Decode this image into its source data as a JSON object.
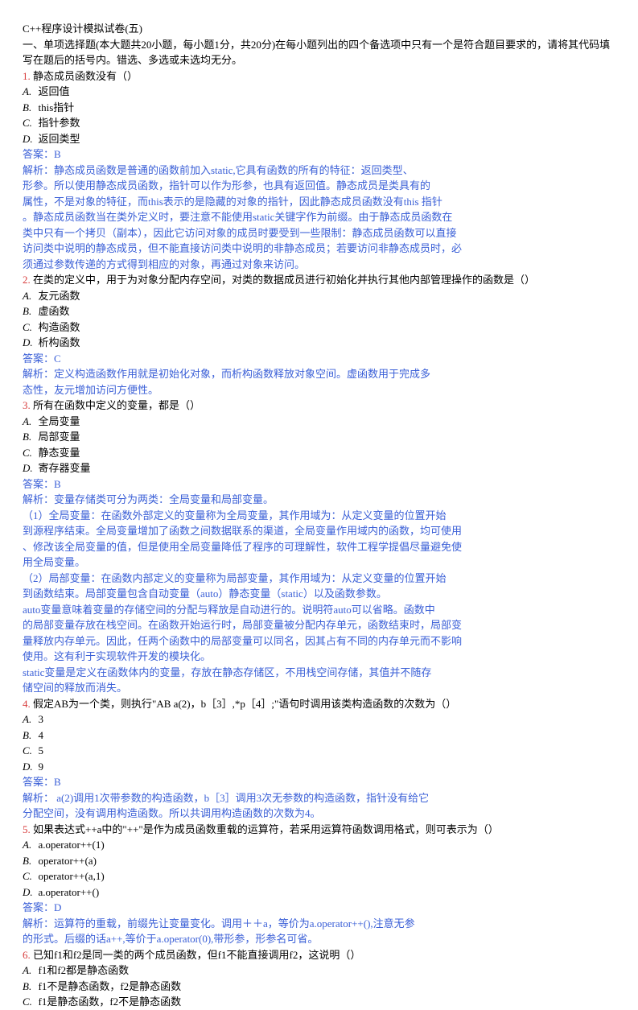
{
  "title": "C++程序设计模拟试卷(五)",
  "section_header": "一、单项选择题(本大题共20小题，每小题1分，共20分)在每小题列出的四个备选项中只有一个是符合题目要求的，请将其代码填写在题后的括号内。错选、多选或未选均无分。",
  "q1": {
    "num": "1.",
    "text": "静态成员函数没有（）",
    "optA": "返回值",
    "optB": "this指针",
    "optC": "指针参数",
    "optD": "返回类型",
    "answer": "答案：B",
    "explain": [
      "解析：静态成员函数是普通的函数前加入static,它具有函数的所有的特征：返回类型、",
      "形参。所以使用静态成员函数，指针可以作为形参，也具有返回值。静态成员是类具有的",
      "属性，不是对象的特征，而this表示的是隐藏的对象的指针，因此静态成员函数没有this 指针",
      "。静态成员函数当在类外定义时，要注意不能使用static关键字作为前缀。由于静态成员函数在",
      "类中只有一个拷贝（副本），因此它访问对象的成员时要受到一些限制：静态成员函数可以直接",
      "访问类中说明的静态成员，但不能直接访问类中说明的非静态成员；若要访问非静态成员时，必",
      "须通过参数传递的方式得到相应的对象，再通过对象来访问。"
    ]
  },
  "q2": {
    "num": "2.",
    "text": "在类的定义中，用于为对象分配内存空间，对类的数据成员进行初始化并执行其他内部管理操作的函数是（）",
    "optA": "友元函数",
    "optB": "虚函数",
    "optC": "构造函数",
    "optD": "析构函数",
    "answer": "答案：C",
    "explain": [
      "解析：定义构造函数作用就是初始化对象，而析构函数释放对象空间。虚函数用于完成多",
      "态性，友元增加访问方便性。"
    ]
  },
  "q3": {
    "num": "3.",
    "text": "所有在函数中定义的变量，都是（）",
    "optA": "全局变量",
    "optB": "局部变量",
    "optC": "静态变量",
    "optD": "寄存器变量",
    "answer": "答案：B",
    "explain": [
      "解析：变量存储类可分为两类：全局变量和局部变量。",
      "（1）全局变量：在函数外部定义的变量称为全局变量，其作用域为：从定义变量的位置开始",
      "到源程序结束。全局变量增加了函数之间数据联系的渠道，全局变量作用域内的函数，均可使用",
      "、修改该全局变量的值，但是使用全局变量降低了程序的可理解性，软件工程学提倡尽量避免使",
      "用全局变量。",
      "（2）局部变量：在函数内部定义的变量称为局部变量，其作用域为：从定义变量的位置开始",
      "到函数结束。局部变量包含自动变量（auto）静态变量（static）以及函数参数。",
      "auto变量意味着变量的存储空间的分配与释放是自动进行的。说明符auto可以省略。函数中",
      "的局部变量存放在栈空间。在函数开始运行时，局部变量被分配内存单元，函数结束时，局部变",
      "量释放内存单元。因此，任两个函数中的局部变量可以同名，因其占有不同的内存单元而不影响",
      "使用。这有利于实现软件开发的模块化。",
      "static变量是定义在函数体内的变量，存放在静态存储区，不用栈空间存储，其值并不随存",
      "储空间的释放而消失。"
    ]
  },
  "q4": {
    "num": "4.",
    "text": "假定AB为一个类，则执行\"AB a(2)，b［3］,*p［4］;\"语句时调用该类构造函数的次数为（）",
    "optA": "3",
    "optB": "4",
    "optC": "5",
    "optD": "9",
    "answer": "答案：B",
    "explain": [
      "解析： a(2)调用1次带参数的构造函数，b［3］调用3次无参数的构造函数，指针没有给它",
      "分配空间，没有调用构造函数。所以共调用构造函数的次数为4。"
    ]
  },
  "q5": {
    "num": "5.",
    "text": "如果表达式++a中的\"++\"是作为成员函数重载的运算符，若采用运算符函数调用格式，则可表示为（）",
    "optA": "a.operator++(1)",
    "optB": "operator++(a)",
    "optC": "operator++(a,1)",
    "optD": "a.operator++()",
    "answer": "答案：D",
    "explain": [
      "解析：运算符的重载，前缀先让变量变化。调用＋＋a，等价为a.operator++(),注意无参",
      "的形式。后缀的话a++,等价于a.operator(0),带形参，形参名可省。"
    ]
  },
  "q6": {
    "num": "6.",
    "text": "已知f1和f2是同一类的两个成员函数，但f1不能直接调用f2，这说明（）",
    "optA": "f1和f2都是静态函数",
    "optB": "f1不是静态函数，f2是静态函数",
    "optC": "f1是静态函数，f2不是静态函数"
  }
}
